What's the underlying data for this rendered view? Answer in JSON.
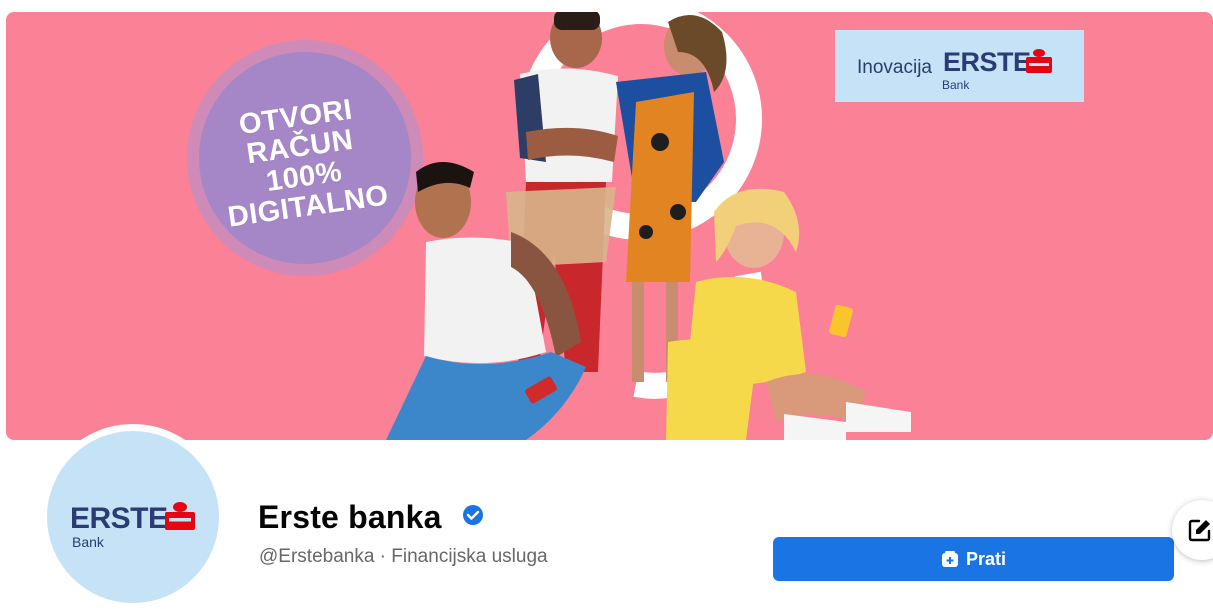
{
  "cover": {
    "promo_lines": [
      "OTVORI",
      "RAČUN",
      "100%",
      "DIGITALNO"
    ],
    "badge": {
      "word": "Inovacija",
      "brand": "ERSTE",
      "sub": "Bank"
    }
  },
  "profile": {
    "avatar": {
      "brand": "ERSTE",
      "sub": "Bank"
    },
    "name": "Erste banka",
    "subtitle": "@Erstebanka · Financijska usluga"
  },
  "actions": {
    "follow_label": "Prati"
  },
  "colors": {
    "cover_bg": "#fb8196",
    "brand_blue": "#2b3c74",
    "brand_red": "#e30613",
    "fb_blue": "#1b74e4"
  }
}
